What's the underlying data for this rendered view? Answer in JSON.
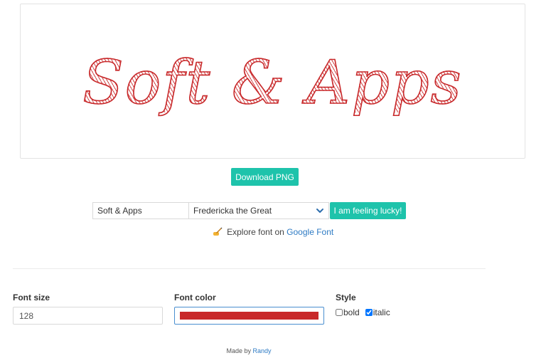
{
  "preview": {
    "text": "Soft & Apps",
    "color": "#c8282a"
  },
  "toolbar": {
    "download_label": "Download PNG",
    "text_value": "Soft & Apps",
    "font_selected": "Fredericka the Great",
    "lucky_label": "I am feeling lucky!",
    "accent_color": "#1ec3ab"
  },
  "explore": {
    "prefix": "Explore font on",
    "link_label": "Google Font",
    "icon": "writing-hand-icon"
  },
  "settings": {
    "font_size_label": "Font size",
    "font_size_value": "128",
    "font_color_label": "Font color",
    "font_color_value": "#c8282a",
    "style_label": "Style",
    "bold_label": "bold",
    "bold_checked": false,
    "italic_label": "italic",
    "italic_checked": true
  },
  "footer": {
    "prefix": "Made by",
    "author": "Randy"
  }
}
